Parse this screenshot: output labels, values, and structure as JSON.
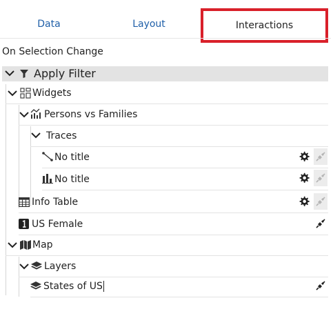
{
  "tabs": {
    "data": "Data",
    "layout": "Layout",
    "interactions": "Interactions"
  },
  "section_label": "On Selection Change",
  "filter": {
    "label": "Apply Filter"
  },
  "tree": {
    "widgets": "Widgets",
    "persons_vs_families": "Persons vs Families",
    "traces": "Traces",
    "trace_1": "No title",
    "trace_2": "No title",
    "info_table": "Info Table",
    "us_female": "US Female",
    "map": "Map",
    "layers": "Layers",
    "states_of_us": "States of US"
  },
  "colors": {
    "active_tab_border": "#d9202a",
    "link_tab": "#1f5fa8",
    "filter_bar": "#e3e3e3",
    "plug_disabled": "#b5b5b5"
  }
}
